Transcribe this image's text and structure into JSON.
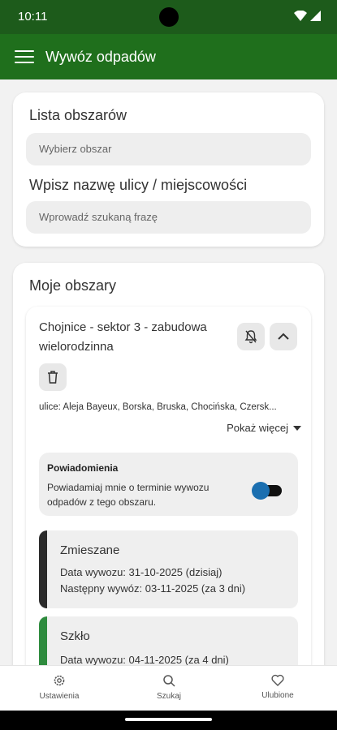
{
  "status": {
    "time": "10:11"
  },
  "appbar": {
    "title": "Wywóz odpadów"
  },
  "search_card": {
    "areas_label": "Lista obszarów",
    "areas_placeholder": "Wybierz obszar",
    "street_label": "Wpisz nazwę ulicy / miejscowości",
    "street_placeholder": "Wprowadź szukaną frazę"
  },
  "my_areas": {
    "title": "Moje obszary",
    "area": {
      "name": "Chojnice - sektor 3 - zabudowa wielorodzinna",
      "streets": "ulice: Aleja Bayeux, Borska, Bruska, Chocińska, Czersk...",
      "show_more": "Pokaż więcej",
      "notifications": {
        "title": "Powiadomienia",
        "description": "Powiadamiaj mnie o terminie wywozu odpadów z tego obszaru.",
        "enabled": true
      },
      "collections": [
        {
          "name": "Zmieszane",
          "date": "Data wywozu: 31-10-2025 (dzisiaj)",
          "next": "Następny wywóz: 03-11-2025 (za 3 dni)",
          "color": "#2b2b2b"
        },
        {
          "name": "Szkło",
          "date": "Data wywozu: 04-11-2025 (za 4 dni)",
          "color": "#2e8b3e"
        }
      ]
    }
  },
  "bottom_nav": [
    {
      "label": "Ustawienia",
      "icon": "gear-icon"
    },
    {
      "label": "Szukaj",
      "icon": "search-icon"
    },
    {
      "label": "Ulubione",
      "icon": "heart-icon"
    }
  ],
  "colors": {
    "statusbar": "#1d5b1b",
    "appbar": "#1f6f1c",
    "toggle_knob": "#1b6fb0"
  }
}
